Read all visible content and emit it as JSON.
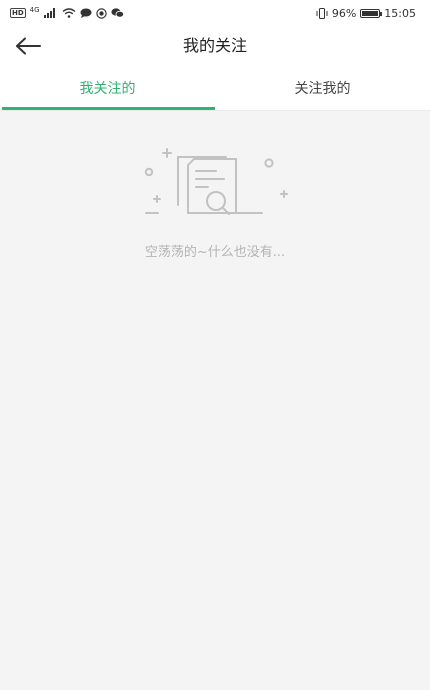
{
  "status_bar": {
    "hd_badge": "HD",
    "network_badge": "4G",
    "battery_percent": "96%",
    "battery_level": 0.96,
    "time": "15:05",
    "icons": [
      "hd-icon",
      "signal-icon",
      "wifi-icon",
      "chat-bubble-icon",
      "record-icon",
      "wechat-icon",
      "vibrate-icon",
      "battery-icon"
    ]
  },
  "nav": {
    "title": "我的关注",
    "back_icon": "arrow-left-icon"
  },
  "tabs": [
    {
      "label": "我关注的",
      "active": true
    },
    {
      "label": "关注我的",
      "active": false
    }
  ],
  "colors": {
    "accent": "#2fb36f",
    "background": "#f4f4f4",
    "empty_text": "#b4b4b4",
    "illustration": "#c2c2c2"
  },
  "empty_state": {
    "icon": "document-search-icon",
    "message": "空荡荡的~什么也没有..."
  }
}
